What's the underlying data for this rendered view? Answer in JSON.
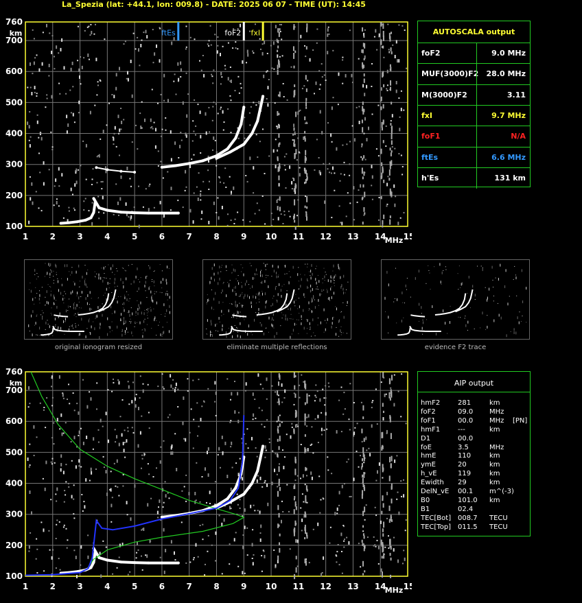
{
  "header": "La_Spezia (lat: +44.1, lon: 009.8) - DATE: 2025 06 07 - TIME (UT): 14:45",
  "chart_data": [
    {
      "type": "scatter",
      "title": "",
      "xlabel": "MHz",
      "ylabel": "km",
      "xlim": [
        1,
        15
      ],
      "ylim": [
        100,
        760
      ],
      "x_ticks": [
        "1",
        "2",
        "3",
        "4",
        "5",
        "6",
        "7",
        "8",
        "9",
        "10",
        "11",
        "12",
        "13",
        "14",
        "15"
      ],
      "y_ticks": [
        "100",
        "200",
        "300",
        "400",
        "500",
        "600",
        "700",
        "760"
      ],
      "markers": [
        {
          "name": "ftEs",
          "x": 6.6,
          "color": "#3399ff"
        },
        {
          "name": "foF2",
          "x": 9.0,
          "color": "#ffffff"
        },
        {
          "name": "fxI",
          "x": 9.7,
          "color": "#ffff33"
        }
      ],
      "traces": [
        {
          "name": "Es",
          "x": [
            2.3,
            2.6,
            2.9,
            3.2,
            3.4,
            3.5,
            3.55
          ],
          "y": [
            110,
            112,
            115,
            120,
            128,
            145,
            175
          ]
        },
        {
          "name": "E",
          "x": [
            3.5,
            3.7,
            4.0,
            4.5,
            5.0,
            5.5,
            6.0,
            6.6
          ],
          "y": [
            190,
            160,
            152,
            146,
            144,
            143,
            143,
            143
          ]
        },
        {
          "name": "F2-o",
          "x": [
            6.0,
            6.5,
            7.0,
            7.5,
            8.0,
            8.4,
            8.7,
            8.9,
            9.0
          ],
          "y": [
            291,
            296,
            303,
            312,
            328,
            350,
            385,
            430,
            485
          ]
        },
        {
          "name": "F2-x",
          "x": [
            8.0,
            8.5,
            9.0,
            9.3,
            9.5,
            9.6,
            9.7
          ],
          "y": [
            320,
            340,
            365,
            400,
            440,
            480,
            520
          ]
        },
        {
          "name": "F1-faint",
          "x": [
            3.6,
            4.0,
            4.5,
            5.0
          ],
          "y": [
            290,
            283,
            278,
            275
          ]
        }
      ]
    },
    {
      "type": "scatter",
      "title": "",
      "xlabel": "MHz",
      "ylabel": "km",
      "xlim": [
        1,
        15
      ],
      "ylim": [
        100,
        760
      ],
      "x_ticks": [
        "1",
        "2",
        "3",
        "4",
        "5",
        "6",
        "7",
        "8",
        "9",
        "10",
        "11",
        "12",
        "13",
        "14",
        "15"
      ],
      "y_ticks": [
        "100",
        "200",
        "300",
        "400",
        "500",
        "600",
        "700",
        "760"
      ],
      "traces": [
        {
          "name": "Es",
          "x": [
            2.3,
            2.6,
            2.9,
            3.2,
            3.4,
            3.5,
            3.55
          ],
          "y": [
            110,
            112,
            115,
            120,
            128,
            145,
            175
          ]
        },
        {
          "name": "E",
          "x": [
            3.5,
            3.7,
            4.0,
            4.5,
            5.0,
            5.5,
            6.0,
            6.6
          ],
          "y": [
            190,
            160,
            152,
            146,
            144,
            143,
            143,
            143
          ]
        },
        {
          "name": "F2-o",
          "x": [
            6.0,
            6.5,
            7.0,
            7.5,
            8.0,
            8.4,
            8.7,
            8.9,
            9.0
          ],
          "y": [
            291,
            296,
            303,
            312,
            328,
            350,
            385,
            430,
            485
          ]
        },
        {
          "name": "F2-x",
          "x": [
            8.0,
            8.5,
            9.0,
            9.3,
            9.5,
            9.6,
            9.7
          ],
          "y": [
            320,
            340,
            365,
            400,
            440,
            480,
            520
          ]
        }
      ],
      "fit_virtual_height": {
        "color": "#2233ff",
        "x": [
          1.0,
          2.0,
          3.0,
          3.3,
          3.45,
          3.6,
          3.8,
          4.2,
          5.0,
          6.0,
          7.0,
          8.0,
          8.5,
          8.8,
          8.95,
          9.0
        ],
        "y": [
          103,
          105,
          112,
          125,
          160,
          280,
          255,
          250,
          262,
          285,
          302,
          320,
          345,
          385,
          470,
          620
        ]
      },
      "fit_density_profile": {
        "color": "#22cc22",
        "x": [
          1.2,
          1.6,
          2.2,
          3.0,
          4.0,
          5.0,
          6.0,
          7.0,
          8.0,
          8.7,
          9.0,
          8.6,
          7.5,
          6.0,
          5.0,
          4.0,
          3.5,
          3.3
        ],
        "y": [
          760,
          680,
          590,
          510,
          455,
          415,
          380,
          345,
          318,
          300,
          290,
          270,
          245,
          226,
          210,
          185,
          155,
          130
        ]
      }
    }
  ],
  "autoscala": {
    "title": "AUTOSCALA output",
    "rows": [
      {
        "label": "foF2",
        "value": "9.0 MHz",
        "color": "#ffffff"
      },
      {
        "label": "MUF(3000)F2",
        "value": "28.0 MHz",
        "color": "#ffffff"
      },
      {
        "label": "M(3000)F2",
        "value": "3.11",
        "color": "#ffffff"
      },
      {
        "label": "fxI",
        "value": "9.7 MHz",
        "color": "#ffff33"
      },
      {
        "label": "foF1",
        "value": "N/A",
        "color": "#ff2222"
      },
      {
        "label": "ftEs",
        "value": "6.6 MHz",
        "color": "#3399ff"
      },
      {
        "label": "h'Es",
        "value": "131    km",
        "color": "#ffffff"
      }
    ]
  },
  "aip": {
    "title": "AIP output",
    "rows": [
      {
        "name": "hmF2",
        "value": "281",
        "unit": "km",
        "extra": ""
      },
      {
        "name": "foF2",
        "value": "09.0",
        "unit": "MHz",
        "extra": ""
      },
      {
        "name": "foF1",
        "value": "00.0",
        "unit": "MHz",
        "extra": "[PN]"
      },
      {
        "name": "hmF1",
        "value": "---",
        "unit": "km",
        "extra": ""
      },
      {
        "name": "D1",
        "value": "00.0",
        "unit": "",
        "extra": ""
      },
      {
        "name": "foE",
        "value": "3.5",
        "unit": "MHz",
        "extra": ""
      },
      {
        "name": "hmE",
        "value": "110",
        "unit": "km",
        "extra": ""
      },
      {
        "name": "ymE",
        "value": "20",
        "unit": "km",
        "extra": ""
      },
      {
        "name": "h_vE",
        "value": "119",
        "unit": "km",
        "extra": ""
      },
      {
        "name": "Ewidth",
        "value": "29",
        "unit": "km",
        "extra": ""
      },
      {
        "name": "DelN_vE",
        "value": "00.1",
        "unit": "m^(-3)",
        "extra": ""
      },
      {
        "name": "B0",
        "value": "101.0",
        "unit": "km",
        "extra": ""
      },
      {
        "name": "B1",
        "value": "02.4",
        "unit": "",
        "extra": ""
      },
      {
        "name": "TEC[Bot]",
        "value": "008.7",
        "unit": "TECU",
        "extra": ""
      },
      {
        "name": "TEC[Top]",
        "value": "011.5",
        "unit": "TECU",
        "extra": ""
      }
    ]
  },
  "thumbnails": [
    {
      "caption": "original ionogram resized"
    },
    {
      "caption": "eliminate multiple reflections"
    },
    {
      "caption": "evidence F2 trace"
    }
  ]
}
